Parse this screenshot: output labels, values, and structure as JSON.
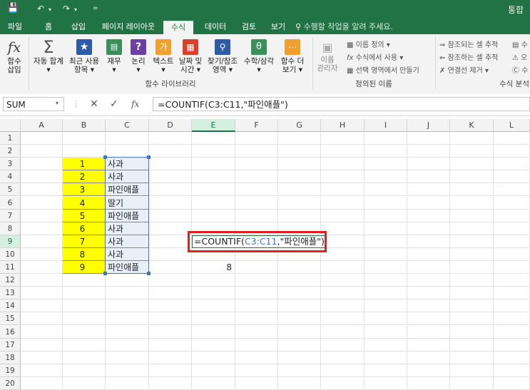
{
  "titlebar": {
    "right_text": "통합"
  },
  "tabs": [
    {
      "label": "파일"
    },
    {
      "label": "홈"
    },
    {
      "label": "삽입"
    },
    {
      "label": "페이지 레이아웃"
    },
    {
      "label": "수식"
    },
    {
      "label": "데이터"
    },
    {
      "label": "검토"
    },
    {
      "label": "보기"
    }
  ],
  "tell_me": "수행할 작업을 알려 주세요.",
  "ribbon": {
    "buttons": [
      {
        "line1": "함수",
        "line2": "삽입"
      },
      {
        "line1": "자동 합계",
        "line2": "▾"
      },
      {
        "line1": "최근 사용",
        "line2": "항목 ▾"
      },
      {
        "line1": "재무",
        "line2": "▾"
      },
      {
        "line1": "논리",
        "line2": "▾"
      },
      {
        "line1": "텍스트",
        "line2": "▾"
      },
      {
        "line1": "날짜 및",
        "line2": "시간 ▾"
      },
      {
        "line1": "찾기/참조",
        "line2": "영역 ▾"
      },
      {
        "line1": "수학/삼각",
        "line2": "▾"
      },
      {
        "line1": "함수 더",
        "line2": "보기 ▾"
      }
    ],
    "name_manager": {
      "line1": "이름",
      "line2": "관리자"
    },
    "names_items": [
      "이름 정의 ▾",
      "수식에서 사용 ▾",
      "선택 영역에서 만들기"
    ],
    "audit_items": [
      "참조되는 셀 추적",
      "참조하는 셀 추적",
      "연결선 제거 ▾"
    ],
    "audit_right": [
      "수",
      "오",
      "수"
    ],
    "groups": {
      "library": "함수 라이브러리",
      "names": "정의된 이름",
      "audit": "수식 분석"
    }
  },
  "formula_bar": {
    "name_box": "SUM",
    "fx": "fx",
    "formula": "=COUNTIF(C3:C11,\"파인애플\")"
  },
  "columns": [
    "A",
    "B",
    "C",
    "D",
    "E",
    "F",
    "G",
    "H",
    "I",
    "J",
    "K",
    "L"
  ],
  "rows": [
    "1",
    "2",
    "3",
    "4",
    "5",
    "6",
    "7",
    "8",
    "9",
    "10",
    "11",
    "12",
    "13",
    "14",
    "15",
    "16",
    "17",
    "18",
    "19",
    "20"
  ],
  "sheet": {
    "b_values": [
      "1",
      "2",
      "3",
      "4",
      "5",
      "6",
      "7",
      "8",
      "9"
    ],
    "c_values": [
      "사과",
      "사과",
      "파인애플",
      "딸기",
      "파인애플",
      "사과",
      "사과",
      "사과",
      "파인애플"
    ],
    "edit_formula": {
      "head": "=COUNTIF(",
      "range": "C3:C11",
      "tail": ",\"파인애플\")"
    },
    "result": "8",
    "highlight_color": "#ffff00",
    "range_color": "#4472c4",
    "box_color": "#e02020"
  }
}
